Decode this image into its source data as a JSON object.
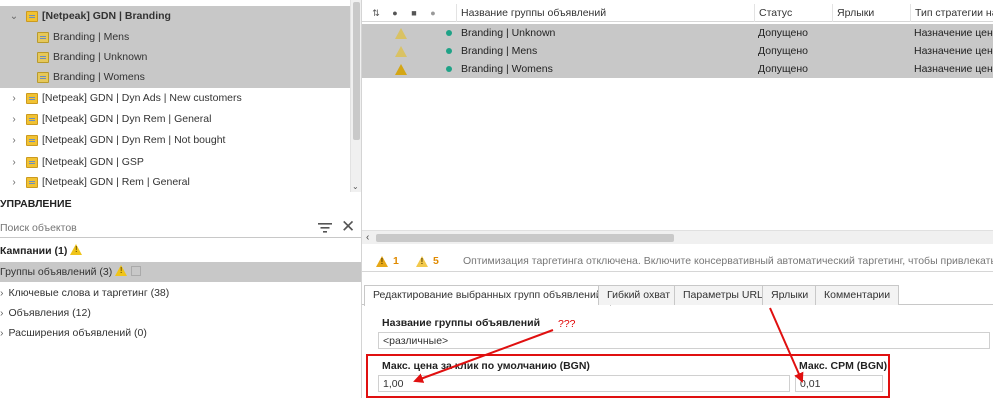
{
  "tree": {
    "items": [
      {
        "label": "[Netpeak] GDN | Branding",
        "chevron": "⌄",
        "bold": true,
        "selected": true,
        "level": 0
      },
      {
        "label": "Branding | Mens",
        "selected": true,
        "level": 1
      },
      {
        "label": "Branding | Unknown",
        "selected": true,
        "level": 1
      },
      {
        "label": "Branding | Womens",
        "selected": true,
        "level": 1
      },
      {
        "label": "[Netpeak] GDN | Dyn Ads | New customers",
        "chevron": "›",
        "level": 0
      },
      {
        "label": "[Netpeak] GDN | Dyn Rem | General",
        "chevron": "›",
        "level": 0
      },
      {
        "label": "[Netpeak] GDN | Dyn Rem | Not bought",
        "chevron": "›",
        "level": 0
      },
      {
        "label": "[Netpeak] GDN | GSP",
        "chevron": "›",
        "level": 0
      },
      {
        "label": "[Netpeak] GDN | Rem | General",
        "chevron": "›",
        "level": 0
      }
    ]
  },
  "management": {
    "title": "УПРАВЛЕНИЕ",
    "search_placeholder": "Поиск объектов",
    "close_glyph": "✕",
    "nav": [
      {
        "label": "Кампании (1)",
        "bold": true,
        "warn": true
      },
      {
        "label": "Группы объявлений (3)",
        "selected": true,
        "warn": true,
        "box": true
      },
      {
        "label": "Ключевые слова и таргетинг (38)",
        "chevron": "›"
      },
      {
        "label": "Объявления (12)",
        "chevron": "›"
      },
      {
        "label": "Расширения объявлений (0)",
        "chevron": "›"
      }
    ]
  },
  "grid": {
    "header_icons": [
      "⇅",
      "●",
      "■",
      "●"
    ],
    "columns": [
      "Название группы объявлений",
      "Статус",
      "Ярлыки",
      "Тип стратегии на"
    ],
    "rows": [
      {
        "name": "Branding | Unknown",
        "status": "Допущено",
        "labels": "",
        "strategy": "Назначение цены"
      },
      {
        "name": "Branding | Mens",
        "status": "Допущено",
        "labels": "",
        "strategy": "Назначение цены"
      },
      {
        "name": "Branding | Womens",
        "status": "Допущено",
        "labels": "",
        "strategy": "Назначение цены"
      }
    ]
  },
  "notifications": {
    "errors": "1",
    "warnings": "5",
    "message": "Оптимизация таргетинга отключена. Включите консервативный автоматический таргетинг, чтобы привлекать нов"
  },
  "editor": {
    "tabs": [
      "Редактирование выбранных групп объявлений",
      "Гибкий охват",
      "Параметры URL",
      "Ярлыки",
      "Комментарии"
    ],
    "name_label": "Название группы объявлений",
    "name_value": "<различные>",
    "cpc_label": "Макс. цена за клик по умолчанию (BGN)",
    "cpc_value": "1,00",
    "cpm_label": "Макс. CPM (BGN)",
    "cpm_value": "0,01"
  },
  "annotations": {
    "question": "???",
    "color": "#e01010"
  }
}
